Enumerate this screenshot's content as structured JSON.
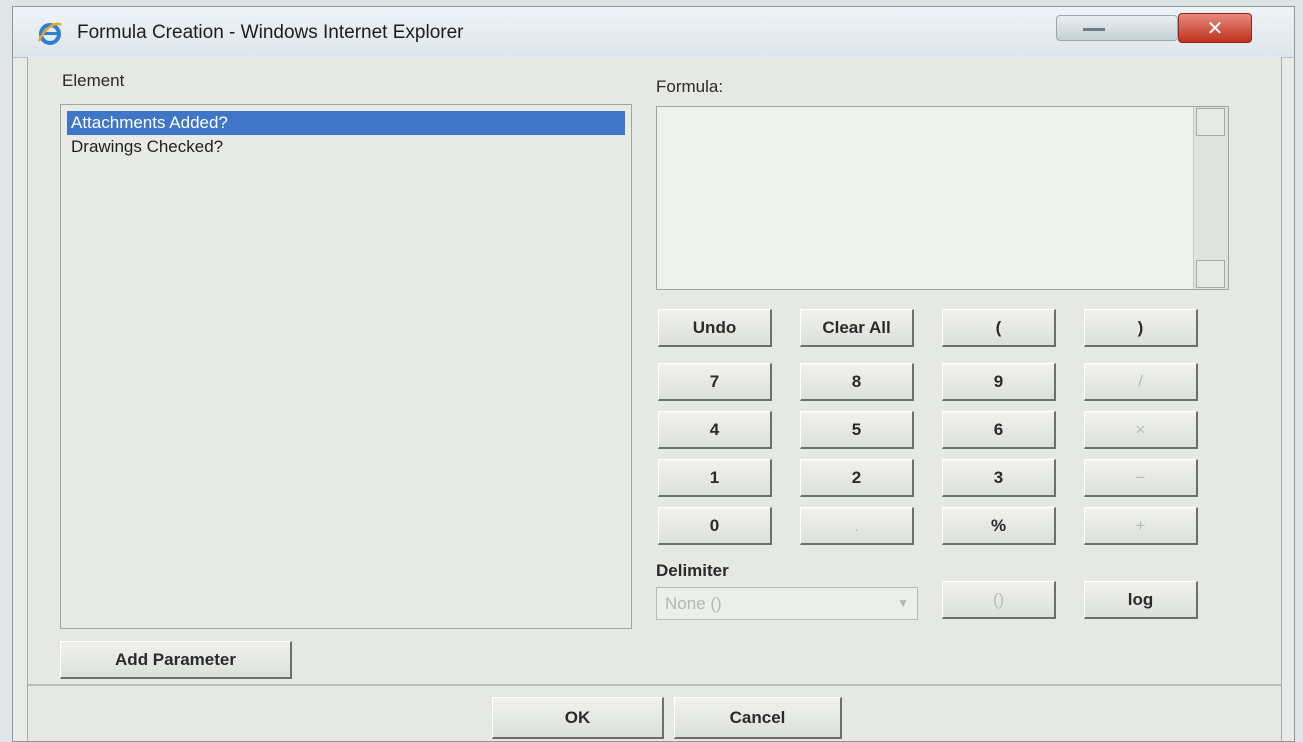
{
  "window": {
    "title": "Formula Creation - Windows Internet Explorer",
    "minimize_icon": "minimize-icon",
    "close_icon": "close-icon",
    "close_glyph": "✕"
  },
  "element_panel": {
    "label": "Element",
    "items": [
      {
        "label": "Attachments Added?",
        "selected": true
      },
      {
        "label": "Drawings Checked?",
        "selected": false
      }
    ],
    "add_parameter_label": "Add Parameter"
  },
  "formula_panel": {
    "label": "Formula:",
    "value": ""
  },
  "keypad": {
    "row1": [
      "Undo",
      "Clear All",
      "(",
      ")"
    ],
    "row2": [
      "7",
      "8",
      "9",
      "/"
    ],
    "row3": [
      "4",
      "5",
      "6",
      "×"
    ],
    "row4": [
      "1",
      "2",
      "3",
      "−"
    ],
    "row5": [
      "0",
      ".",
      "%",
      "+"
    ],
    "log_label": "log",
    "delimiter_button_label": "()"
  },
  "delimiter": {
    "label": "Delimiter",
    "selected": "None ()"
  },
  "footer": {
    "ok_label": "OK",
    "cancel_label": "Cancel"
  },
  "colors": {
    "selection": "#3f76c8",
    "close_button": "#c0301d"
  }
}
